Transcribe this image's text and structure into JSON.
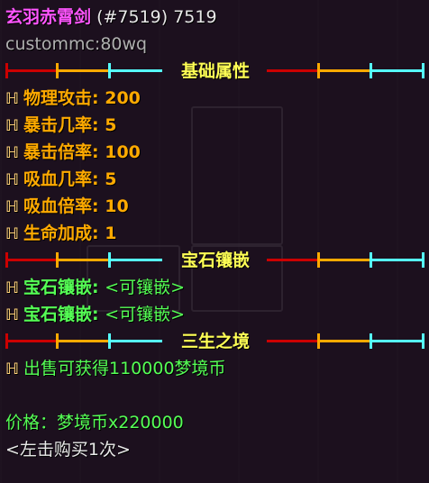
{
  "item": {
    "name": "玄羽赤霄剑",
    "id_text": "(#7519) 7519",
    "owner": "custommc:80wq"
  },
  "colors": {
    "name": "#ff55ff",
    "stat": "#ffaa00",
    "gem": "#55ff55",
    "section_title": "#ffff55",
    "divider_red": "#cc0000",
    "divider_orange": "#ffaa00",
    "divider_cyan": "#55ffff"
  },
  "sections": {
    "attributes_title": "基础属性",
    "gems_title": "宝石镶嵌",
    "realm_title": "三生之境"
  },
  "stats": [
    {
      "label": "物理攻击",
      "value": "200"
    },
    {
      "label": "暴击几率",
      "value": "5"
    },
    {
      "label": "暴击倍率",
      "value": "100"
    },
    {
      "label": "吸血几率",
      "value": "5"
    },
    {
      "label": "吸血倍率",
      "value": "10"
    },
    {
      "label": "生命加成",
      "value": "1"
    }
  ],
  "gems": [
    {
      "label": "宝石镶嵌",
      "value": "<可镶嵌>"
    },
    {
      "label": "宝石镶嵌",
      "value": "<可镶嵌>"
    }
  ],
  "bullet_glyph": "ℍ",
  "sell_text": "出售可获得110000梦境币",
  "price_text": "价格：梦境币x220000",
  "buy_text": "<左击购买1次>"
}
